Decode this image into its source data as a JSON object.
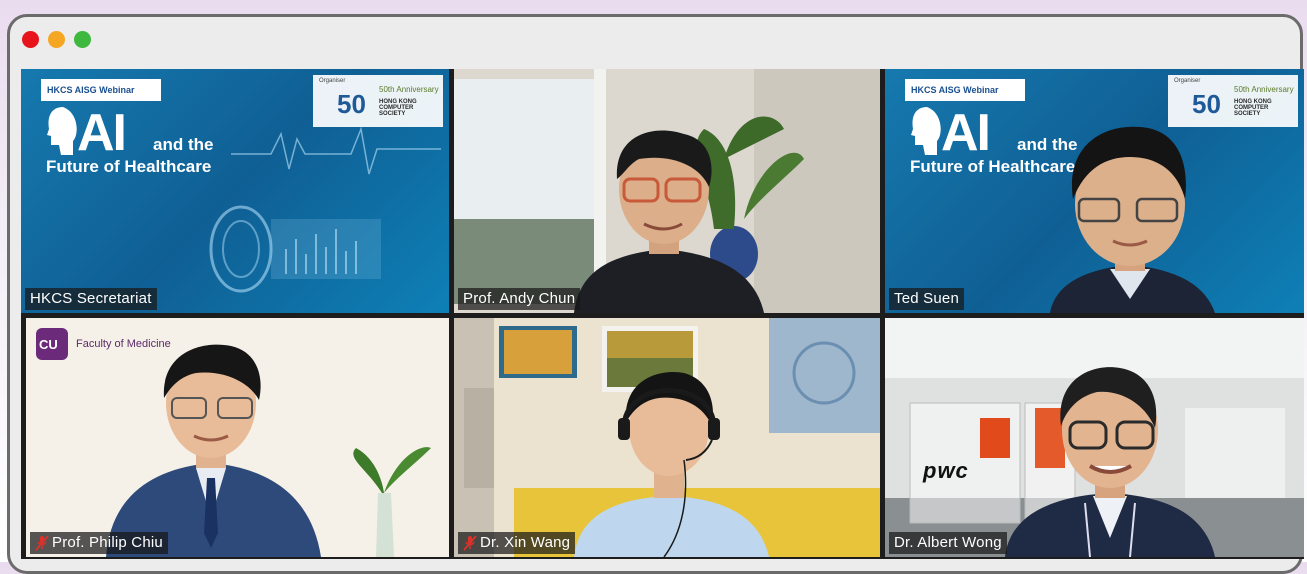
{
  "window": {
    "controls": [
      {
        "name": "close",
        "color": "#e8141b"
      },
      {
        "name": "minimize",
        "color": "#f5a623"
      },
      {
        "name": "zoom",
        "color": "#3fb83e"
      }
    ]
  },
  "slide": {
    "header": "HKCS AISG Webinar",
    "title_big": "AI",
    "title_and": "and the",
    "title_sub": "Future of Healthcare",
    "org_label": "Organiser",
    "anniversary": "50th Anniversary",
    "fifty": "50",
    "org_name": "HONG KONG COMPUTER SOCIETY"
  },
  "participants": [
    {
      "name": "HKCS Secretariat",
      "muted": false,
      "active": true
    },
    {
      "name": "Prof. Andy Chun",
      "muted": false,
      "active": false
    },
    {
      "name": "Ted Suen",
      "muted": false,
      "active": false
    },
    {
      "name": "Prof. Philip Chiu",
      "muted": true,
      "active": false
    },
    {
      "name": "Dr. Xin Wang",
      "muted": true,
      "active": false
    },
    {
      "name": "Dr. Albert Wong",
      "muted": false,
      "active": false
    }
  ],
  "backgrounds": {
    "cuhk_logo": "CU",
    "cuhk_faculty": "Faculty of Medicine",
    "pwc": "pwc"
  },
  "colors": {
    "active_border": "#b8e34b",
    "slide_blue": "#1679ae"
  }
}
